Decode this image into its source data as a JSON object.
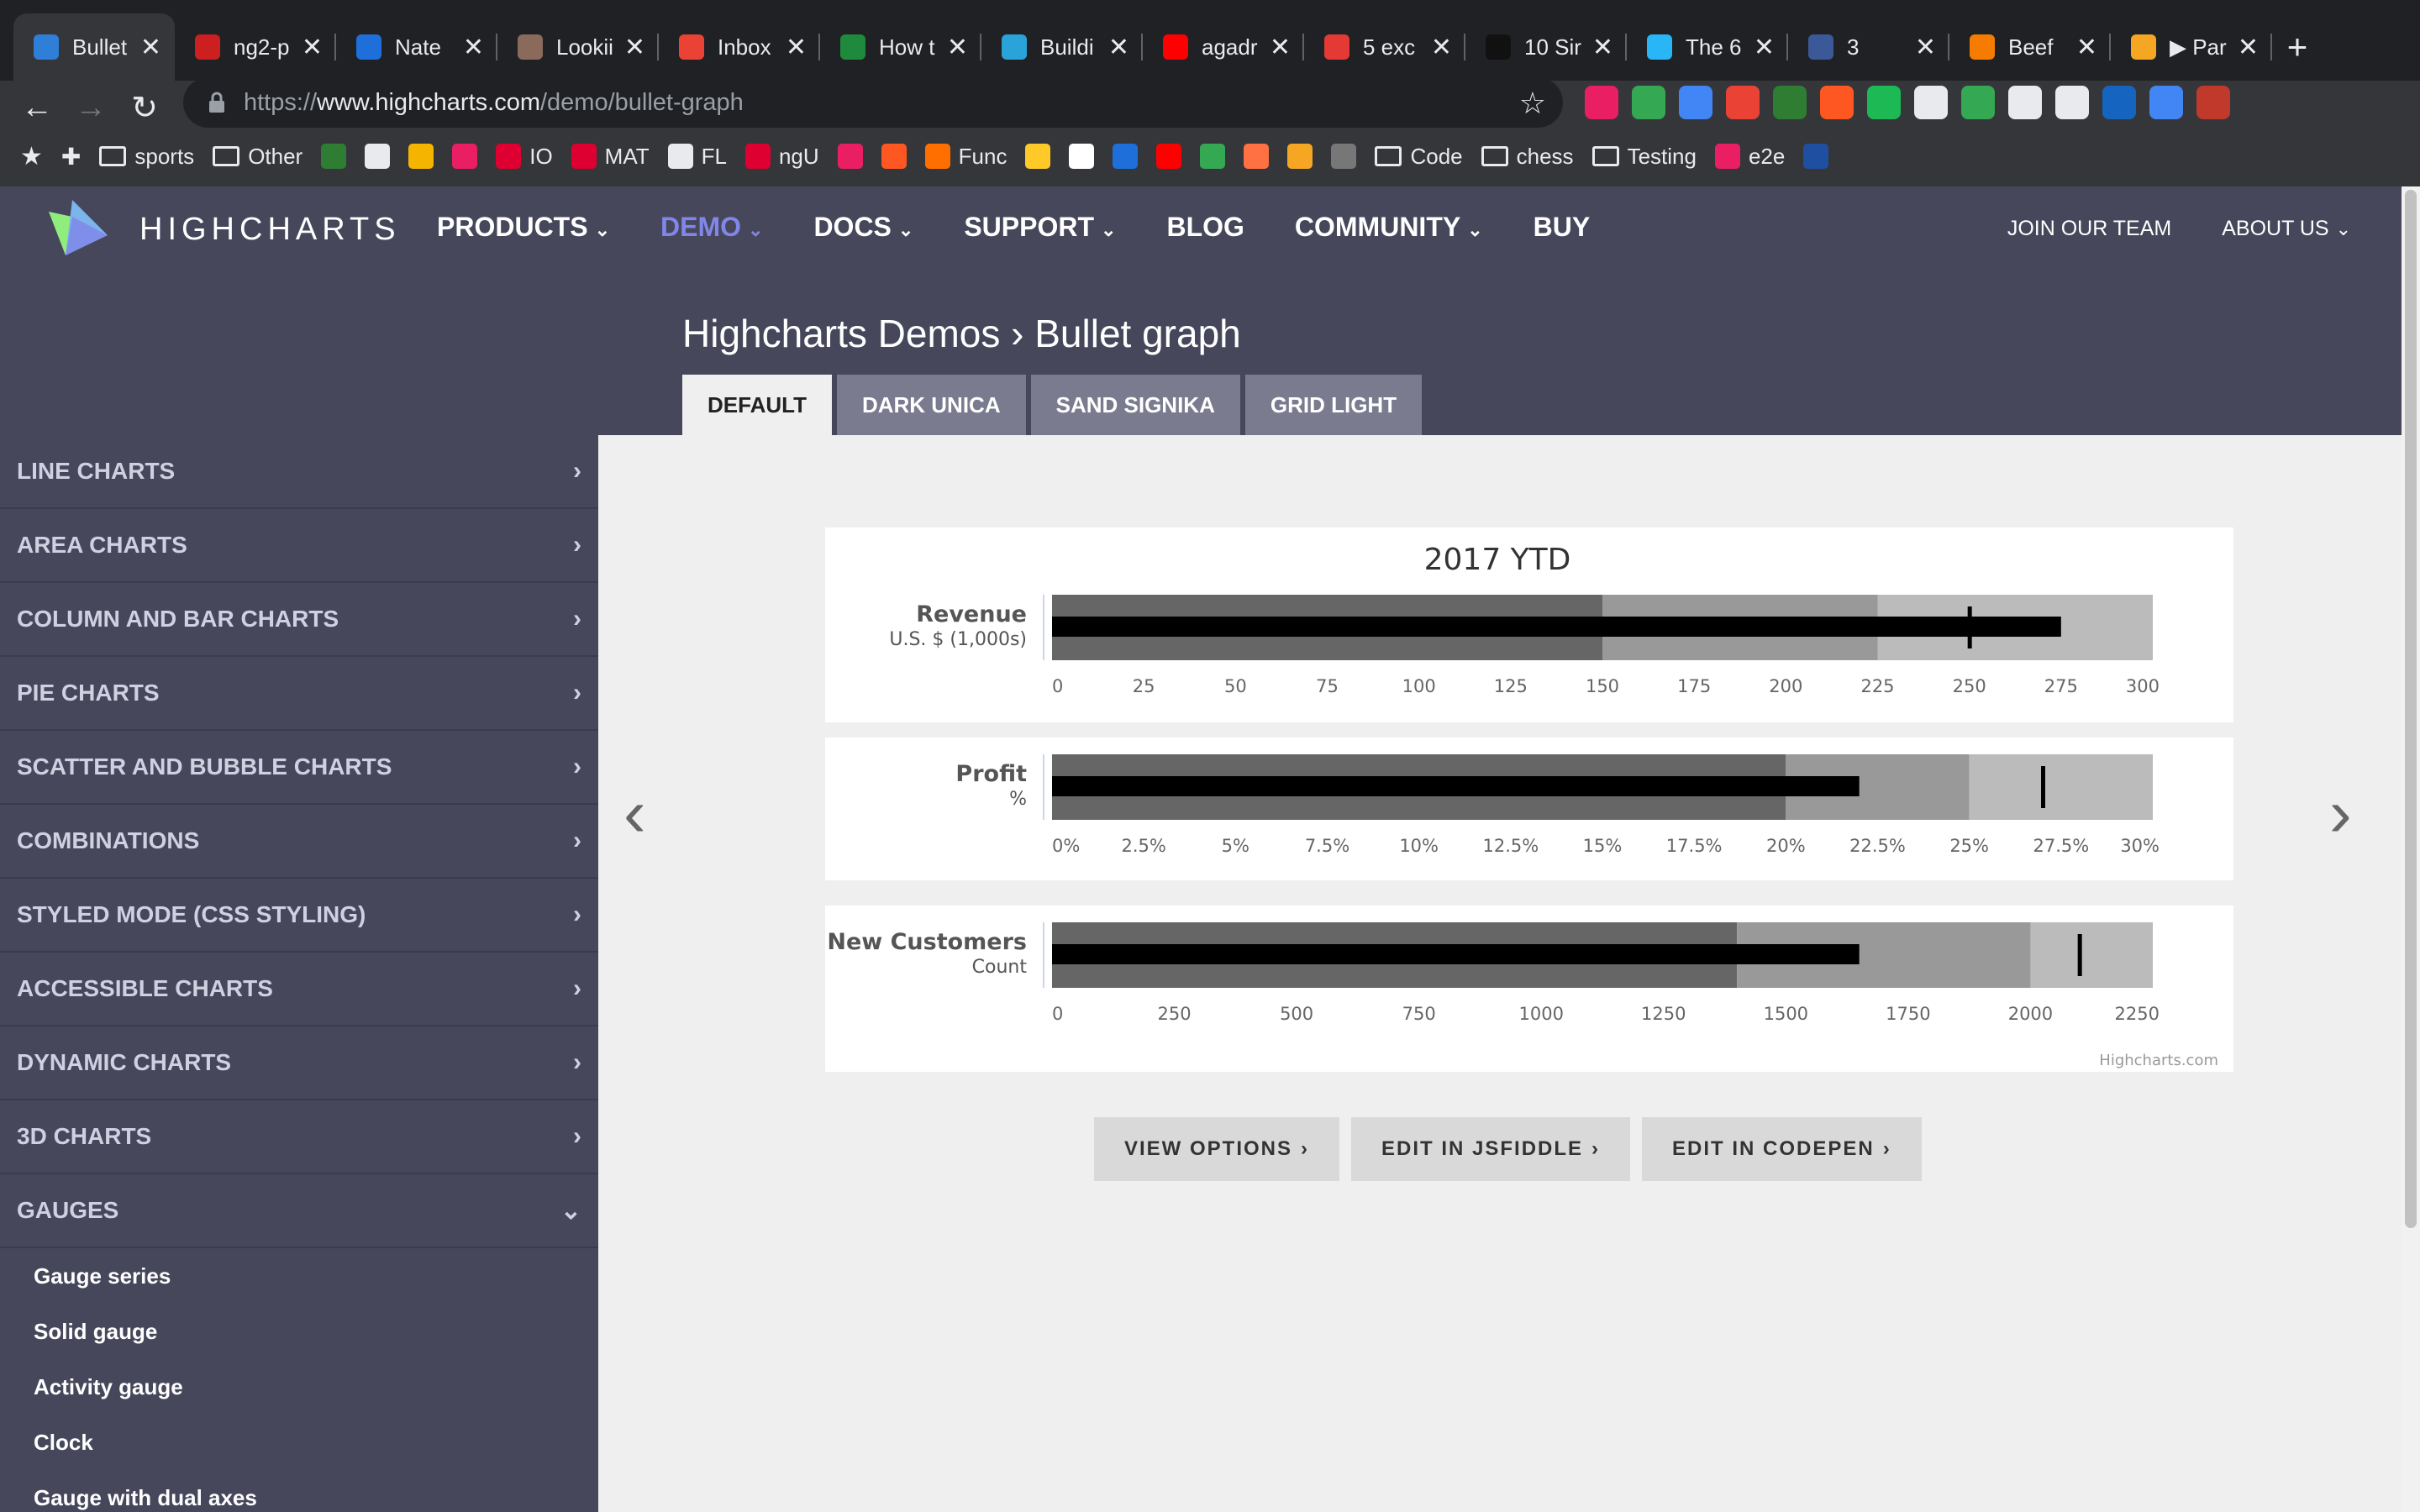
{
  "browser": {
    "tabs": [
      {
        "title": "Bullet",
        "color": "#2f7ed8",
        "active": true
      },
      {
        "title": "ng2-p",
        "color": "#cc1f1f"
      },
      {
        "title": "Nate",
        "color": "#1e6fd9"
      },
      {
        "title": "Lookii",
        "color": "#8a6a5a"
      },
      {
        "title": "Inbox",
        "color": "#ea4335"
      },
      {
        "title": "How t",
        "color": "#1f8a3b"
      },
      {
        "title": "Buildi",
        "color": "#2aa3d8"
      },
      {
        "title": "agadr",
        "color": "#ff0000"
      },
      {
        "title": "5 exc",
        "color": "#e53935"
      },
      {
        "title": "10 Sir",
        "color": "#111111"
      },
      {
        "title": "The 6",
        "color": "#29b6f6"
      },
      {
        "title": "3",
        "color": "#3b5998"
      },
      {
        "title": "Beef",
        "color": "#f57c00"
      },
      {
        "title": "▶ Par",
        "color": "#f5a623"
      }
    ],
    "close_glyph": "✕",
    "new_tab_glyph": "+",
    "url_scheme": "https://",
    "url_host": "www.highcharts.com",
    "url_path": "/demo/bullet-graph",
    "bookmarks": [
      {
        "label": "sports",
        "icon": "folder-icon"
      },
      {
        "label": "Other",
        "icon": "folder-icon"
      },
      {
        "label": "",
        "icon": "bookmark-icon",
        "color": "#2e7d32"
      },
      {
        "label": "",
        "icon": "page-icon",
        "color": "#e8eaed"
      },
      {
        "label": "",
        "icon": "bookmark-icon",
        "color": "#f4b400"
      },
      {
        "label": "",
        "icon": "bookmark-icon",
        "color": "#e91e63"
      },
      {
        "label": "IO",
        "icon": "angular-icon",
        "color": "#dd0031"
      },
      {
        "label": "MAT",
        "icon": "angular-icon",
        "color": "#dd0031"
      },
      {
        "label": "FL",
        "icon": "github-icon",
        "color": "#e8eaed"
      },
      {
        "label": "ngU",
        "icon": "angular-icon",
        "color": "#dd0031"
      },
      {
        "label": "",
        "icon": "bookmark-icon",
        "color": "#e91e63"
      },
      {
        "label": "",
        "icon": "bookmark-icon",
        "color": "#ff5722"
      },
      {
        "label": "Func",
        "icon": "firebase-icon",
        "color": "#ff6f00"
      },
      {
        "label": "",
        "icon": "firebase-icon",
        "color": "#ffca28"
      },
      {
        "label": "",
        "icon": "bookmark-icon",
        "color": "#ffffff"
      },
      {
        "label": "",
        "icon": "bookmark-icon",
        "color": "#1e6fd9"
      },
      {
        "label": "",
        "icon": "youtube-icon",
        "color": "#ff0000"
      },
      {
        "label": "",
        "icon": "bookmark-icon",
        "color": "#34a853"
      },
      {
        "label": "",
        "icon": "bookmark-icon",
        "color": "#ff7043"
      },
      {
        "label": "",
        "icon": "bookmark-icon",
        "color": "#f5a623"
      },
      {
        "label": "",
        "icon": "bookmark-icon",
        "color": "#777777"
      },
      {
        "label": "Code",
        "icon": "folder-icon"
      },
      {
        "label": "chess",
        "icon": "folder-icon"
      },
      {
        "label": "Testing",
        "icon": "folder-icon"
      },
      {
        "label": "e2e",
        "icon": "bookmark-icon",
        "color": "#e91e63"
      },
      {
        "label": "",
        "icon": "bookmark-icon",
        "color": "#1e4fa0"
      }
    ],
    "extension_colors": [
      "#e91e63",
      "#34a853",
      "#4285f4",
      "#ea4335",
      "#2e7d32",
      "#ff5722",
      "#1db954",
      "#e8eaed",
      "#34a853",
      "#e8eaed",
      "#e8eaed",
      "#1565c0",
      "#4285f4",
      "#c0392b"
    ]
  },
  "site": {
    "logo_text": "HIGHCHARTS",
    "nav": [
      {
        "label": "PRODUCTS",
        "dropdown": true
      },
      {
        "label": "DEMO",
        "dropdown": true,
        "active": true
      },
      {
        "label": "DOCS",
        "dropdown": true
      },
      {
        "label": "SUPPORT",
        "dropdown": true
      },
      {
        "label": "BLOG",
        "dropdown": false
      },
      {
        "label": "COMMUNITY",
        "dropdown": true
      },
      {
        "label": "BUY",
        "dropdown": false
      }
    ],
    "right_nav": {
      "join": "JOIN OUR TEAM",
      "about": "ABOUT US"
    },
    "page_title": "Highcharts Demos › Bullet graph",
    "theme_tabs": [
      "DEFAULT",
      "DARK UNICA",
      "SAND SIGNIKA",
      "GRID LIGHT"
    ],
    "sidebar": [
      {
        "label": "LINE CHARTS",
        "expanded": false
      },
      {
        "label": "AREA CHARTS",
        "expanded": false
      },
      {
        "label": "COLUMN AND BAR CHARTS",
        "expanded": false
      },
      {
        "label": "PIE CHARTS",
        "expanded": false
      },
      {
        "label": "SCATTER AND BUBBLE CHARTS",
        "expanded": false
      },
      {
        "label": "COMBINATIONS",
        "expanded": false
      },
      {
        "label": "STYLED MODE (CSS STYLING)",
        "expanded": false
      },
      {
        "label": "ACCESSIBLE CHARTS",
        "expanded": false
      },
      {
        "label": "DYNAMIC CHARTS",
        "expanded": false
      },
      {
        "label": "3D CHARTS",
        "expanded": false
      },
      {
        "label": "GAUGES",
        "expanded": true
      }
    ],
    "sidebar_sub": [
      "Gauge series",
      "Solid gauge",
      "Activity gauge",
      "Clock",
      "Gauge with dual axes"
    ],
    "buttons": [
      "VIEW OPTIONS",
      "EDIT IN JSFIDDLE",
      "EDIT IN CODEPEN"
    ],
    "credits": "Highcharts.com"
  },
  "chart_data": {
    "type": "bullet",
    "title": "2017 YTD",
    "bands_colors": [
      "#666666",
      "#999999",
      "#bbbbbb"
    ],
    "bar_color": "#000000",
    "charts": [
      {
        "label": "Revenue",
        "sublabel": "U.S. $ (1,000s)",
        "min": 0,
        "max": 300,
        "ticks": [
          "0",
          "25",
          "50",
          "75",
          "100",
          "125",
          "150",
          "175",
          "200",
          "225",
          "250",
          "275",
          "300"
        ],
        "bands": [
          150,
          225,
          300
        ],
        "value": 275,
        "target": 250
      },
      {
        "label": "Profit",
        "sublabel": "%",
        "min": 0,
        "max": 30,
        "ticks": [
          "0%",
          "2.5%",
          "5%",
          "7.5%",
          "10%",
          "12.5%",
          "15%",
          "17.5%",
          "20%",
          "22.5%",
          "25%",
          "27.5%",
          "30%"
        ],
        "bands": [
          20,
          25,
          30
        ],
        "value": 22,
        "target": 27
      },
      {
        "label": "New Customers",
        "sublabel": "Count",
        "min": 0,
        "max": 2250,
        "ticks": [
          "0",
          "250",
          "500",
          "750",
          "1000",
          "1250",
          "1500",
          "1750",
          "2000",
          "2250"
        ],
        "bands": [
          1400,
          2000,
          2250
        ],
        "value": 1650,
        "target": 2100
      }
    ]
  }
}
